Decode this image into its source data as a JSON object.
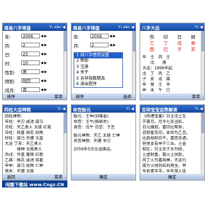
{
  "screens": {
    "input": {
      "title": "周易八字排盘",
      "status_icons": "Y₁ abc ◀",
      "fields": [
        {
          "label": "年:",
          "value": "2006"
        },
        {
          "label": "月:",
          "value": "2"
        },
        {
          "label": "日:",
          "value": "25"
        },
        {
          "label": "时:",
          "value": "10"
        },
        {
          "label": "性别:",
          "value": "男"
        },
        {
          "label": "阴阳:",
          "value": "阳历"
        },
        {
          "label": "闰月:",
          "value": "否"
        }
      ],
      "softkeys": {
        "left": "排序",
        "right": "菜单"
      }
    },
    "menu": {
      "title": "周易八字排盘",
      "status_icons": "Y₁ abc ◀",
      "bg_rows": [
        {
          "label": "年:",
          "value": "2006"
        },
        {
          "label": "月:",
          "value": "2"
        },
        {
          "label": "日:",
          "value": "25"
        }
      ],
      "items": [
        "1 排八字感觉设置",
        "2 帮助",
        "3 注册",
        "4 关于",
        "5 吉祥指数精品",
        "6 退出程序"
      ],
      "softkeys": {
        "left": "排序",
        "right": "选择"
      }
    },
    "chart": {
      "title": "八字大运",
      "status_icons": "Y₁ ◀",
      "header": [
        "伤",
        "印",
        "日",
        "财"
      ],
      "stems": [
        "乙",
        "丁",
        "戊",
        "癸"
      ],
      "branches": [
        "酉",
        "巳",
        "子",
        "亥"
      ],
      "notes": [
        "辛　壬　丙　壬",
        "　　戊　　庚",
        "大运：1996年起",
        "戊　丁　丙　乙",
        "子　亥　戌　酉",
        "甲　癸　壬　辛",
        "申　未　午　巳"
      ],
      "softkeys": {
        "left": "",
        "right": "菜单"
      }
    },
    "dayun": {
      "title": "四柱大运神煞",
      "status_icons": "Y₁ ◀",
      "lines": [
        "四柱神煞：",
        "年柱：羊刃 咸池 驿马",
        "月柱：天乙贵人 太极 红鸾",
        "日柱：将星 桃花 劫煞",
        "时柱：驿马 天德 文昌",
        "大运 丁亥：天乙贵人",
        "　　　禄神 太极贵人",
        "丙戌：华盖 寡宿 红艳",
        "乙酉：桃花 咸池 将星",
        "甲申：驿马 劫煞 亡神",
        "癸未：天德 太极",
        "壬午：羊刃 飞刃"
      ],
      "softkeys": {
        "left": "返回",
        "right": "菜单"
      }
    },
    "destiny": {
      "title": "命宫胎元",
      "status_icons": "Y₁ ◀",
      "lines": [
        "胎元：壬申(剑锋金)",
        "命宫：壬午(杨柳木)",
        "身宫：戊午 日空：子丑",
        "",
        "胎元神煞：天乙 太极 亡神",
        "命宫神煞：天德 羊刃",
        "",
        "2056年5月交运换运。"
      ],
      "softkeys": {
        "left": "",
        "right": "确定"
      }
    },
    "analysis": {
      "title": "吉祥宝宝运势解读",
      "status_icons": "Y₁ ◀",
      "lines": [
        "《命理宝鉴》日主戊土生",
        "于寅月，月令七杀当权，",
        "日元偏弱，喜印比帮身，",
        "忌财星克印。本命为乙丑，",
        "比肩劫财日干，喜官杀透，",
        "但地支有申子三合，土金",
        "相生；日主坐子水为财，",
        "土虚财重，需火土扶助，",
        "丙丁火为喜用神，大运行",
        "南方火地则名利两全。早",
        "年衣食平平，中年渐入佳",
        "境，晚年福寿康宁。"
      ],
      "softkeys": {
        "left": "",
        "right": "确定"
      }
    }
  },
  "watermark": "闲趣下载站 www.Cngz.CN",
  "colors": {
    "titlebar": "#1d57b8",
    "selection": "#245ecc",
    "softbar": "#bcd0ea",
    "red": "#d01010"
  }
}
